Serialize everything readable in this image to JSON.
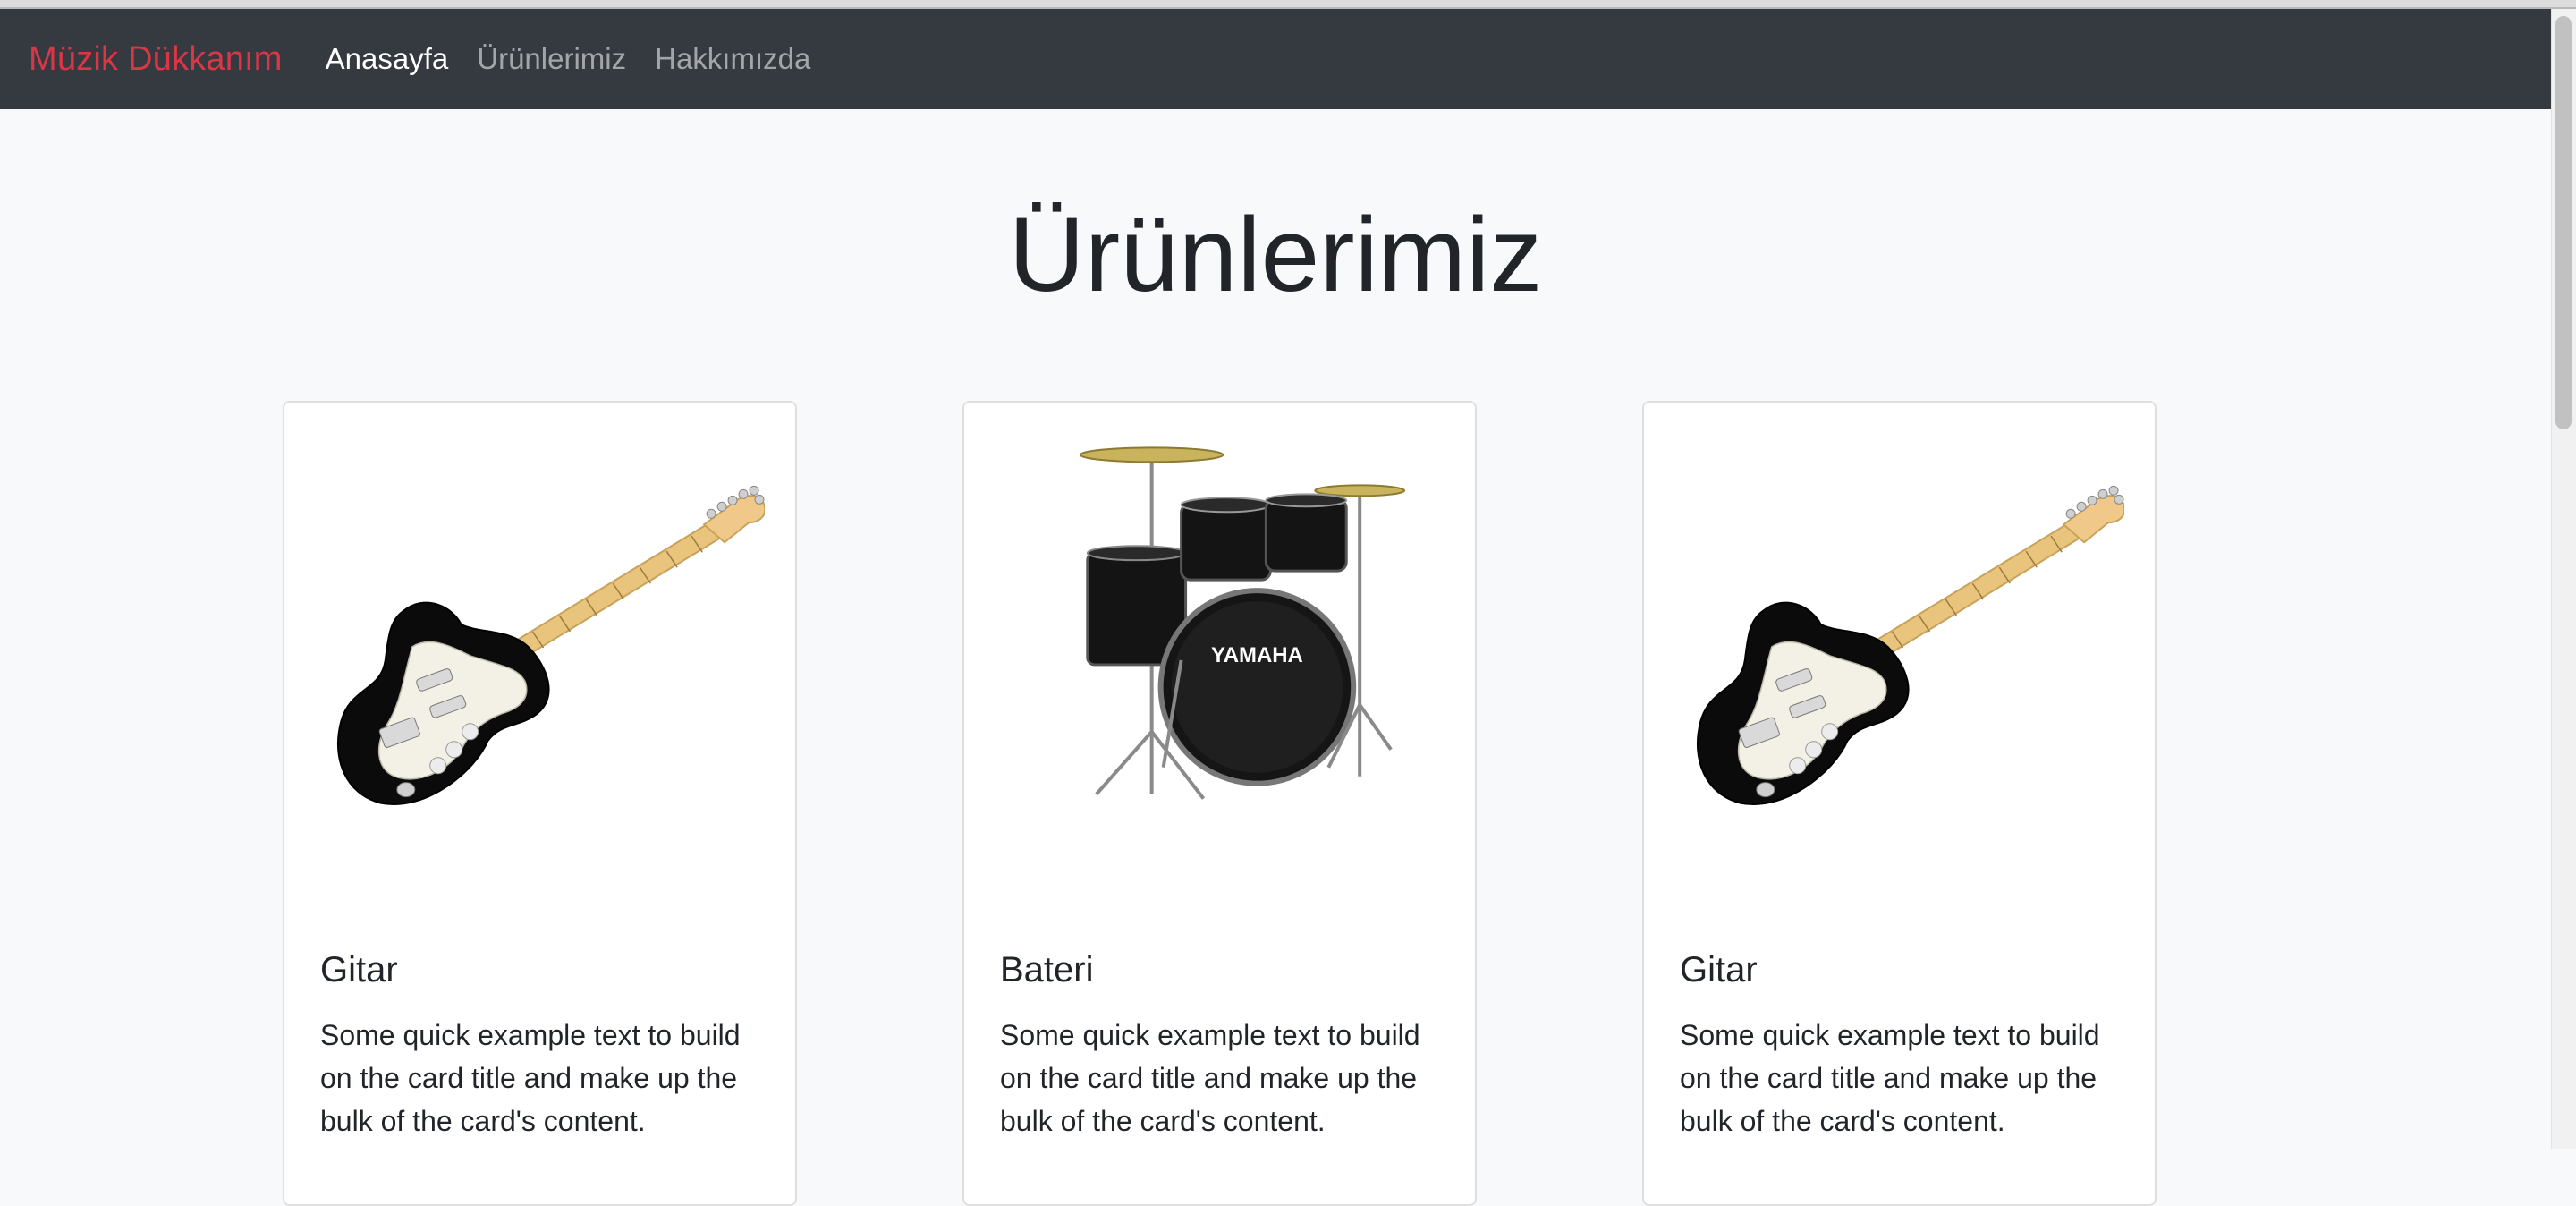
{
  "navbar": {
    "brand": "Müzik Dükkanım",
    "links": [
      {
        "label": "Anasayfa",
        "active": true
      },
      {
        "label": "Ürünlerimiz",
        "active": false
      },
      {
        "label": "Hakkımızda",
        "active": false
      }
    ]
  },
  "page": {
    "title": "Ürünlerimiz"
  },
  "cards": [
    {
      "title": "Gitar",
      "text": "Some quick example text to build on the card title and make up the bulk of the card's content.",
      "image": "electric-guitar"
    },
    {
      "title": "Bateri",
      "text": "Some quick example text to build on the card title and make up the bulk of the card's content.",
      "image": "drum-kit"
    },
    {
      "title": "Gitar",
      "text": "Some quick example text to build on the card title and make up the bulk of the card's content.",
      "image": "electric-guitar"
    }
  ],
  "colors": {
    "navbar_bg": "#343a40",
    "brand": "#dc3545",
    "page_bg": "#f8f9fa"
  }
}
